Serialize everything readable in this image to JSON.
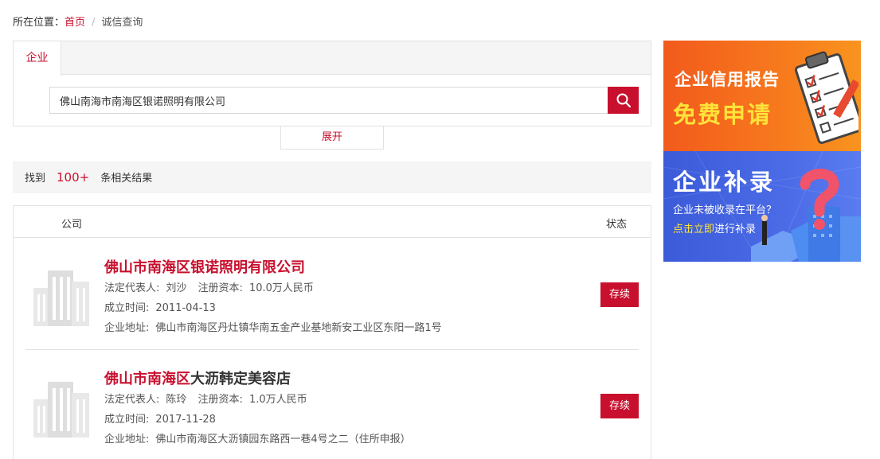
{
  "breadcrumb": {
    "prefix": "所在位置：",
    "home": "首页",
    "separator": "/",
    "current": "诚信查询"
  },
  "search": {
    "tab_label": "企业",
    "value": "佛山南海市南海区银诺照明有限公司",
    "button_icon": "search-icon"
  },
  "expand_label": "展开",
  "results": {
    "found_prefix": "找到",
    "count": "100+",
    "found_suffix": "条相关结果"
  },
  "list": {
    "header_company": "公司",
    "header_status": "状态",
    "rows": [
      {
        "name_highlight": "佛山市南海区银诺照明有限公司",
        "name_rest": "",
        "legal_rep_label": "法定代表人:",
        "legal_rep": "刘沙",
        "capital_label": "注册资本:",
        "capital": "10.0万人民币",
        "founded_label": "成立时间:",
        "founded": "2011-04-13",
        "address_label": "企业地址:",
        "address": "佛山市南海区丹灶镇华南五金产业基地新安工业区东阳一路1号",
        "status": "存续"
      },
      {
        "name_highlight": "佛山市南海区",
        "name_rest": "大沥韩定美容店",
        "legal_rep_label": "法定代表人:",
        "legal_rep": "陈玲",
        "capital_label": "注册资本:",
        "capital": "1.0万人民币",
        "founded_label": "成立时间:",
        "founded": "2017-11-28",
        "address_label": "企业地址:",
        "address": "佛山市南海区大沥镇园东路西一巷4号之二（住所申报）",
        "status": "存续"
      }
    ]
  },
  "banners": {
    "credit": {
      "line1": "企业信用报告",
      "line2": "免费申请",
      "icon": "clipboard-checklist-icon"
    },
    "supplement": {
      "line1": "企业补录",
      "line2": "企业未被收录在平台？",
      "line3_highlight": "点击立即",
      "line3_rest": "进行补录",
      "icon": "question-mark-icon"
    }
  },
  "colors": {
    "accent": "#c8102e",
    "banner_orange": "#f77a1d",
    "banner_blue": "#4a6ae6",
    "highlight_yellow": "#ffe33a"
  }
}
